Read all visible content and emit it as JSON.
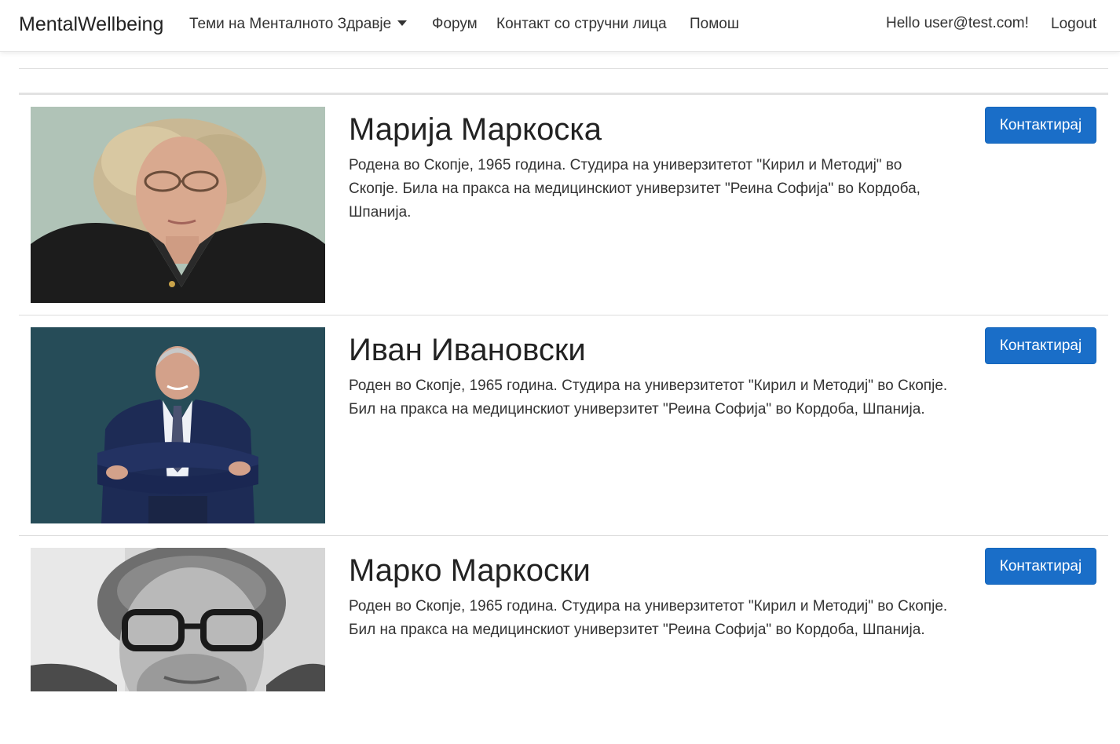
{
  "navbar": {
    "brand": "MentalWellbeing",
    "links": {
      "topics": "Теми на Менталното Здравје",
      "forum": "Форум",
      "contact": "Контакт со стручни лица",
      "help": "Помош"
    },
    "greeting": "Hello user@test.com!",
    "logout": "Logout"
  },
  "experts": [
    {
      "name": "Марија Маркоска",
      "bio": "Родена во Скопје, 1965 година. Студира на универзитетот \"Кирил и Методиј\" во Скопје. Била на пракса на медицинскиот универзитет \"Реина Софија\" во Кордоба, Шпанија.",
      "button": "Контактирај"
    },
    {
      "name": "Иван Ивановски",
      "bio": "Роден во Скопје, 1965 година. Студира на универзитетот \"Кирил и Методиј\" во Скопје. Бил на пракса на медицинскиот универзитет \"Реина Софија\" во Кордоба, Шпанија.",
      "button": "Контактирај"
    },
    {
      "name": "Марко Маркоски",
      "bio": "Роден во Скопје, 1965 година. Студира на универзитетот \"Кирил и Методиј\" во Скопје. Бил на пракса на медицинскиот универзитет \"Реина Софија\" во Кордоба, Шпанија.",
      "button": "Контактирај"
    }
  ],
  "colors": {
    "button_bg": "#1a6ec8",
    "navbar_bg": "#ffffff",
    "text": "#212529"
  }
}
